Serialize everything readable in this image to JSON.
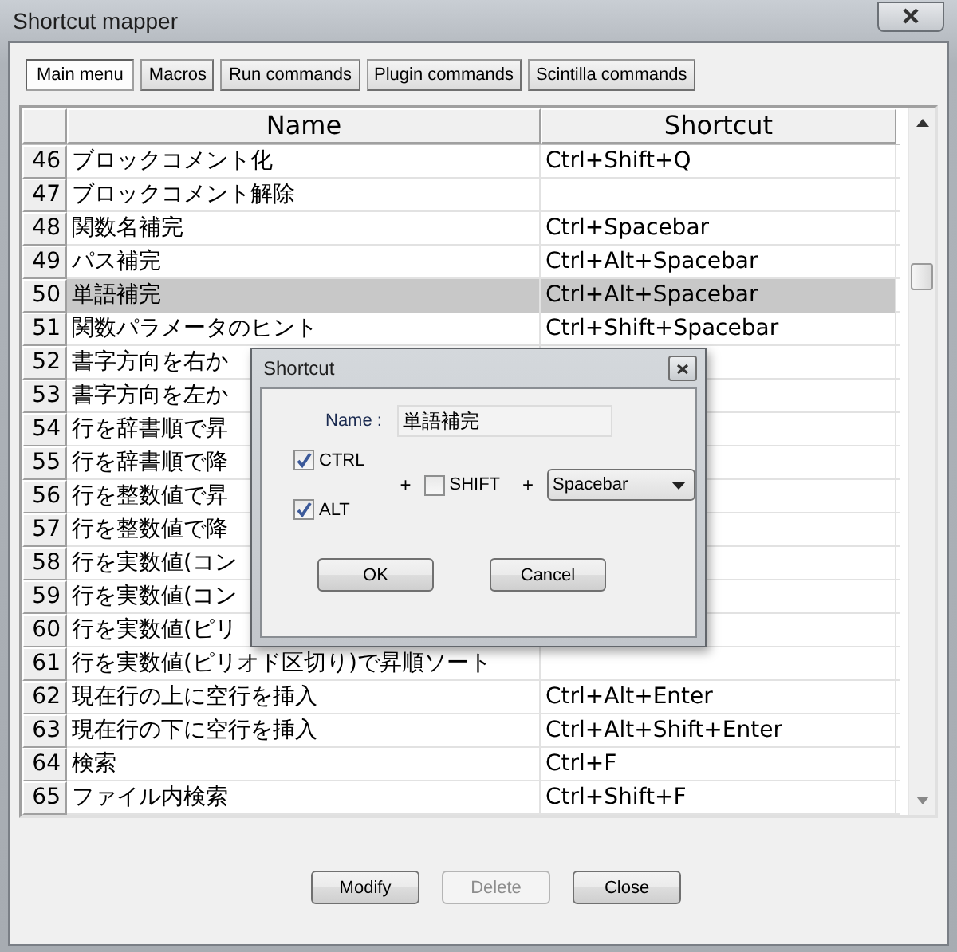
{
  "window": {
    "title": "Shortcut mapper"
  },
  "tabs": [
    {
      "label": "Main menu",
      "selected": true
    },
    {
      "label": "Macros",
      "selected": false
    },
    {
      "label": "Run commands",
      "selected": false
    },
    {
      "label": "Plugin commands",
      "selected": false
    },
    {
      "label": "Scintilla commands",
      "selected": false
    }
  ],
  "table": {
    "columns": [
      "Name",
      "Shortcut"
    ],
    "rows": [
      {
        "number": "46",
        "name": "ブロックコメント化",
        "shortcut": "Ctrl+Shift+Q",
        "selected": false
      },
      {
        "number": "47",
        "name": "ブロックコメント解除",
        "selected": false
      },
      {
        "number": "48",
        "name": "関数名補完",
        "shortcut": "Ctrl+Spacebar",
        "selected": false
      },
      {
        "number": "49",
        "name": "パス補完",
        "shortcut": "Ctrl+Alt+Spacebar",
        "selected": false
      },
      {
        "number": "50",
        "name": "単語補完",
        "shortcut": "Ctrl+Alt+Spacebar",
        "selected": true
      },
      {
        "number": "51",
        "name": "関数パラメータのヒント",
        "shortcut": "Ctrl+Shift+Spacebar",
        "selected": false
      },
      {
        "number": "52",
        "name": "書字方向を右か",
        "selected": false
      },
      {
        "number": "53",
        "name": "書字方向を左か",
        "selected": false
      },
      {
        "number": "54",
        "name": "行を辞書順で昇",
        "selected": false
      },
      {
        "number": "55",
        "name": "行を辞書順で降",
        "selected": false
      },
      {
        "number": "56",
        "name": "行を整数値で昇",
        "selected": false
      },
      {
        "number": "57",
        "name": "行を整数値で降",
        "selected": false
      },
      {
        "number": "58",
        "name": "行を実数値(コン",
        "selected": false
      },
      {
        "number": "59",
        "name": "行を実数値(コン",
        "selected": false
      },
      {
        "number": "60",
        "name": "行を実数値(ピリ",
        "selected": false
      },
      {
        "number": "61",
        "name": "行を実数値(ピリオド区切り)で昇順ソート",
        "selected": false
      },
      {
        "number": "62",
        "name": "現在行の上に空行を挿入",
        "shortcut": "Ctrl+Alt+Enter",
        "selected": false
      },
      {
        "number": "63",
        "name": "現在行の下に空行を挿入",
        "shortcut": "Ctrl+Alt+Shift+Enter",
        "selected": false
      },
      {
        "number": "64",
        "name": "検索",
        "shortcut": "Ctrl+F",
        "selected": false
      },
      {
        "number": "65",
        "name": "ファイル内検索",
        "shortcut": "Ctrl+Shift+F",
        "selected": false
      }
    ]
  },
  "buttons": [
    {
      "label": "Modify",
      "disabled": false
    },
    {
      "label": "Delete",
      "disabled": true
    },
    {
      "label": "Close",
      "disabled": false
    }
  ],
  "dialog": {
    "title": "Shortcut",
    "name_label": "Name :",
    "name_value": "単語補完",
    "left_modifiers": [
      {
        "label": "CTRL",
        "checked": true
      },
      {
        "label": "ALT",
        "checked": true
      }
    ],
    "shift": {
      "label": "SHIFT",
      "checked": false
    },
    "plus_signs": [
      "+",
      "+"
    ],
    "key": "Spacebar",
    "buttons": [
      "OK",
      "Cancel"
    ]
  }
}
